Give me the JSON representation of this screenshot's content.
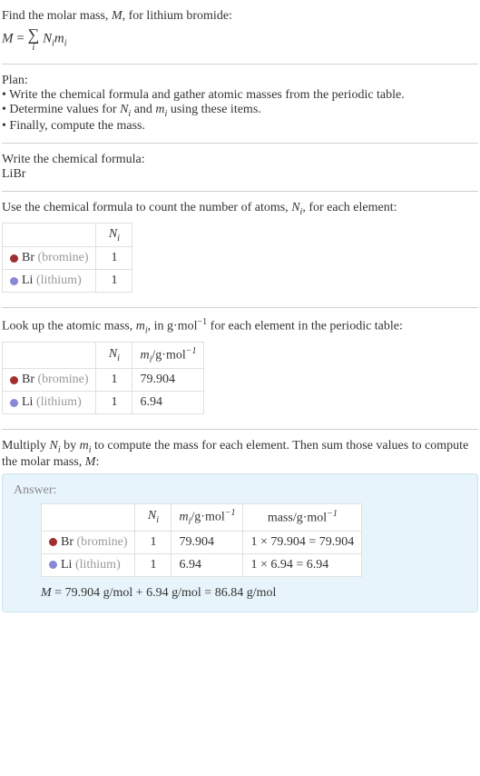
{
  "intro": {
    "line1": "Find the molar mass, ",
    "line1_var": "M",
    "line1_rest": ", for lithium bromide:",
    "eq_left": "M",
    "eq_eq": " = ",
    "sum_sub": "i",
    "eq_right1": "N",
    "eq_right1_sub": "i",
    "eq_right2": "m",
    "eq_right2_sub": "i"
  },
  "plan": {
    "heading": "Plan:",
    "b1": "• Write the chemical formula and gather atomic masses from the periodic table.",
    "b2_a": "• Determine values for ",
    "b2_n": "N",
    "b2_nsub": "i",
    "b2_mid": " and ",
    "b2_m": "m",
    "b2_msub": "i",
    "b2_end": " using these items.",
    "b3": "• Finally, compute the mass."
  },
  "formula_block": {
    "heading": "Write the chemical formula:",
    "formula": "LiBr"
  },
  "count_block": {
    "text_a": "Use the chemical formula to count the number of atoms, ",
    "n": "N",
    "nsub": "i",
    "text_b": ", for each element:"
  },
  "elements": {
    "br_label": "Br",
    "br_paren": " (bromine)",
    "li_label": "Li",
    "li_paren": " (lithium)"
  },
  "table1": {
    "h_n": "N",
    "h_n_sub": "i",
    "br_n": "1",
    "li_n": "1"
  },
  "mass_block": {
    "text_a": "Look up the atomic mass, ",
    "m": "m",
    "msub": "i",
    "text_b": ", in g·mol",
    "exp": "−1",
    "text_c": " for each element in the periodic table:"
  },
  "table2": {
    "h_n": "N",
    "h_n_sub": "i",
    "h_m": "m",
    "h_m_sub": "i",
    "h_m_unit": "/g·mol",
    "h_m_exp": "−1",
    "br_n": "1",
    "br_m": "79.904",
    "li_n": "1",
    "li_m": "6.94"
  },
  "multiply_block": {
    "text_a": "Multiply ",
    "n": "N",
    "nsub": "i",
    "text_b": " by ",
    "m": "m",
    "msub": "i",
    "text_c": " to compute the mass for each element. Then sum those values to compute the molar mass, ",
    "M": "M",
    "text_d": ":"
  },
  "answer": {
    "label": "Answer:",
    "h_n": "N",
    "h_n_sub": "i",
    "h_m": "m",
    "h_m_sub": "i",
    "h_m_unit": "/g·mol",
    "h_m_exp": "−1",
    "h_mass": "mass/g·mol",
    "h_mass_exp": "−1",
    "br_n": "1",
    "br_m": "79.904",
    "br_mass": "1 × 79.904 = 79.904",
    "li_n": "1",
    "li_m": "6.94",
    "li_mass": "1 × 6.94 = 6.94",
    "final_M": "M",
    "final_eq": " = 79.904 g/mol + 6.94 g/mol = 86.84 g/mol"
  }
}
